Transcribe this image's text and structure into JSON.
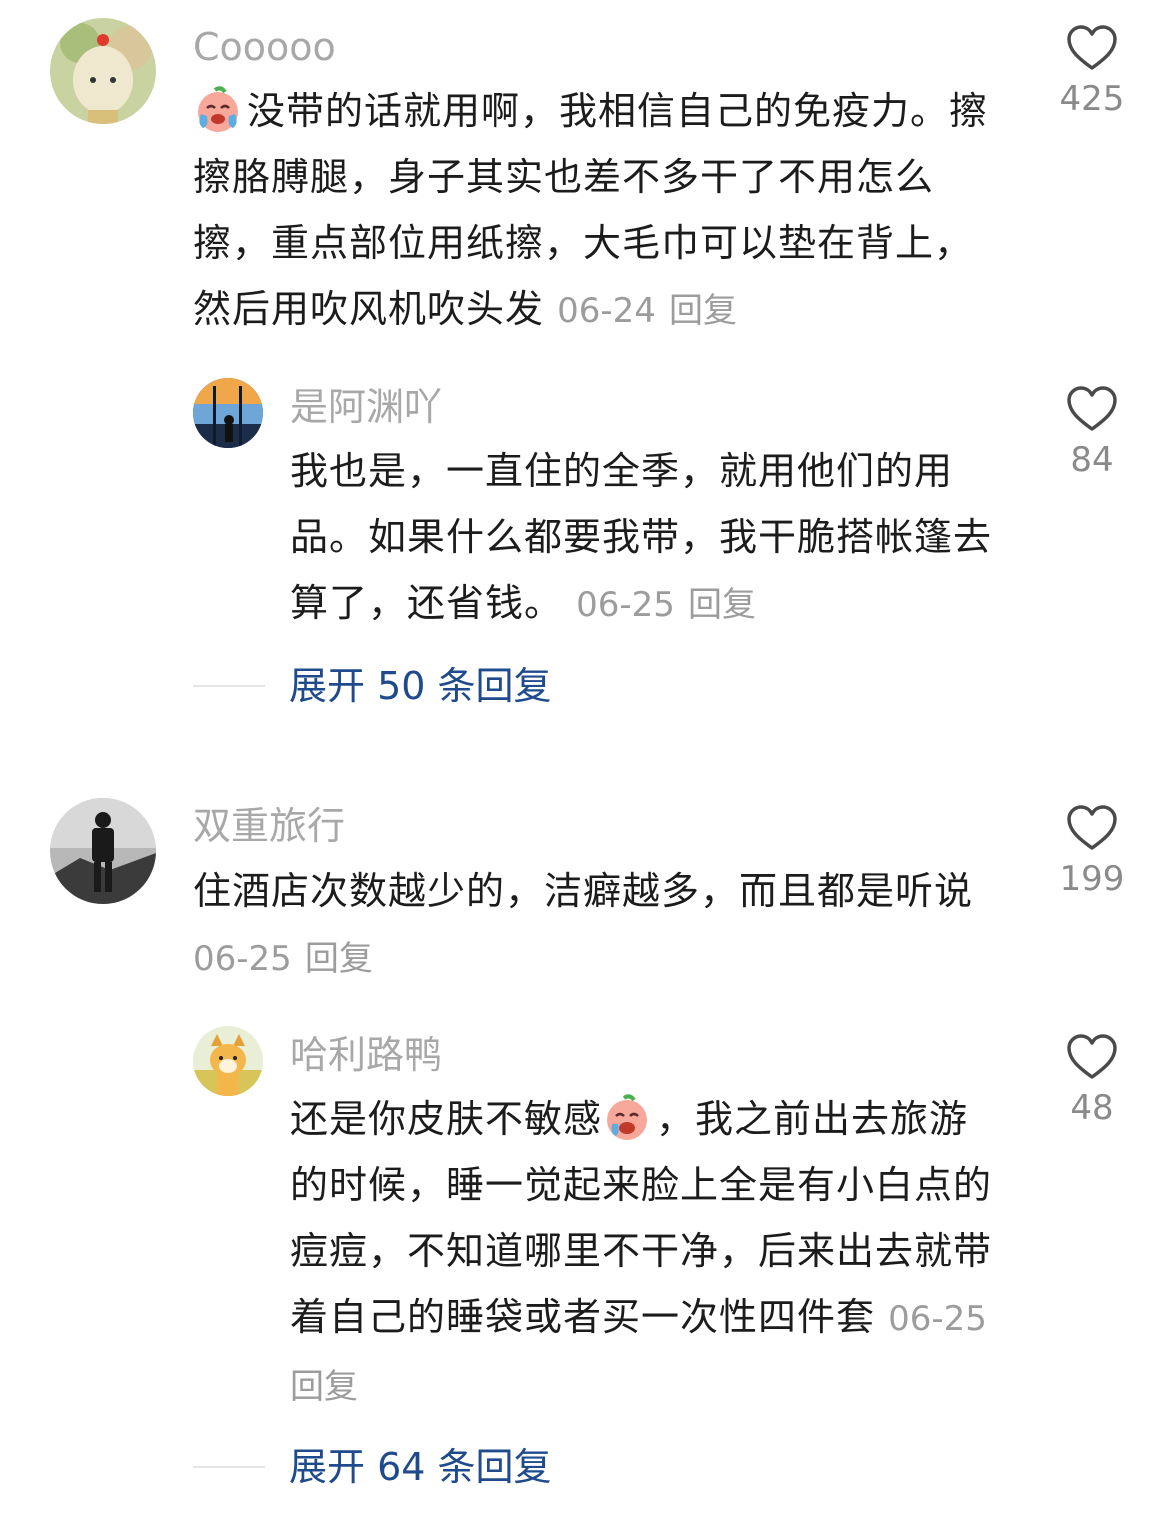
{
  "comments": [
    {
      "username": "Cooooo",
      "avatar_icon": "cute-animal-avatar",
      "emoji_icon": "crying-face-emoji",
      "text": "没带的话就用啊，我相信自己的免疫力。擦擦胳膊腿，身子其实也差不多干了不用怎么擦，重点部位用纸擦，大毛巾可以垫在背上，然后用吹风机吹头发",
      "date": "06-24",
      "reply_label": "回复",
      "likes": "425",
      "replies": [
        {
          "username": "是阿渊吖",
          "avatar_icon": "window-view-avatar",
          "text": "我也是，一直住的全季，就用他们的用品。如果什么都要我带，我干脆搭帐篷去算了，还省钱。",
          "date": "06-25",
          "reply_label": "回复",
          "likes": "84"
        }
      ],
      "expand_label": "展开 50 条回复"
    },
    {
      "username": "双重旅行",
      "avatar_icon": "hiker-silhouette-avatar",
      "text": "住酒店次数越少的，洁癖越多，而且都是听说",
      "date": "06-25",
      "reply_label": "回复",
      "likes": "199",
      "replies": [
        {
          "username": "哈利路鸭",
          "avatar_icon": "cartoon-cat-avatar",
          "emoji_icon": "crying-face-emoji",
          "text_before": "还是你皮肤不敏感",
          "text_after": "，我之前出去旅游的时候，睡一觉起来脸上全是有小白点的痘痘，不知道哪里不干净，后来出去就带着自己的睡袋或者买一次性四件套",
          "date": "06-25",
          "reply_label": "回复",
          "likes": "48"
        }
      ],
      "expand_label": "展开 64 条回复"
    }
  ],
  "colors": {
    "username": "#a8a8a8",
    "text": "#1c1c1c",
    "meta": "#9c9c9c",
    "expand": "#1f4b8c"
  }
}
